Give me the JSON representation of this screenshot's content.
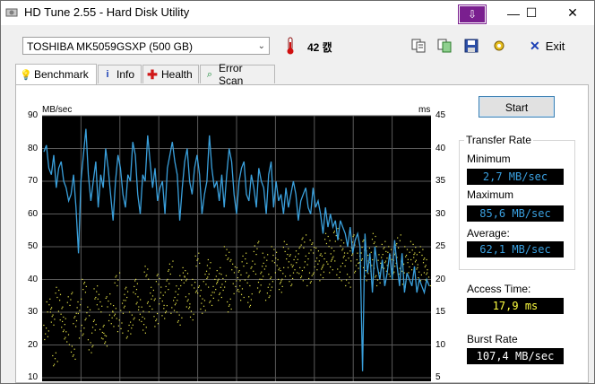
{
  "window": {
    "title": "HD Tune 2.55 - Hard Disk Utility",
    "minimize_glyph": "—",
    "maximize_glyph": "☐",
    "close_glyph": "✕",
    "pin_glyph": "⇩"
  },
  "toolbar": {
    "drive": "TOSHIBA MK5059GSXP (500 GB)",
    "temperature": "42 캜",
    "exit_label": "Exit",
    "icons": [
      "copy-text-icon",
      "copy-screenshot-icon",
      "save-icon",
      "options-icon"
    ]
  },
  "tabs": [
    {
      "label": "Benchmark",
      "icon": "benchmark-icon",
      "active": true
    },
    {
      "label": "Info",
      "icon": "info-icon",
      "active": false
    },
    {
      "label": "Health",
      "icon": "health-cross-icon",
      "active": false
    },
    {
      "label": "Error Scan",
      "icon": "error-scan-icon",
      "active": false
    }
  ],
  "benchmark": {
    "start_label": "Start",
    "transfer_rate_title": "Transfer Rate",
    "minimum_label": "Minimum",
    "minimum_value": "2,7 MB/sec",
    "maximum_label": "Maximum",
    "maximum_value": "85,6 MB/sec",
    "average_label": "Average:",
    "average_value": "62,1 MB/sec",
    "access_label": "Access Time:",
    "access_value": "17,9 ms",
    "burst_label": "Burst Rate",
    "burst_value": "107,4 MB/sec",
    "colors": {
      "transfer": "#3aa0dc",
      "access": "#e8e64a",
      "lcd_blue": "#3aa0e0",
      "lcd_yellow": "#ffff40",
      "lcd_white": "#ffffff"
    }
  },
  "chart_data": {
    "type": "line",
    "left_axis_unit": "MB/sec",
    "right_axis_unit": "ms",
    "left_ticks": [
      "90",
      "80",
      "70",
      "60",
      "50",
      "40",
      "30",
      "20",
      "10"
    ],
    "right_ticks": [
      "45",
      "40",
      "35",
      "30",
      "25",
      "20",
      "15",
      "10",
      "5"
    ],
    "ylim_left": [
      10,
      90
    ],
    "ylim_right": [
      5,
      45
    ],
    "grid": true,
    "series": [
      {
        "axis": "left",
        "values": [
          79,
          81,
          74,
          72,
          78,
          68,
          74,
          76,
          70,
          68,
          64,
          66,
          72,
          62,
          48,
          70,
          78,
          86,
          72,
          64,
          70,
          76,
          62,
          72,
          68,
          80,
          74,
          66,
          58,
          70,
          78,
          74,
          66,
          62,
          72,
          70,
          82,
          78,
          66,
          60,
          72,
          70,
          84,
          76,
          68,
          74,
          64,
          68,
          70,
          60,
          74,
          78,
          82,
          76,
          72,
          58,
          68,
          76,
          80,
          70,
          66,
          74,
          78,
          72,
          60,
          66,
          70,
          84,
          74,
          68,
          70,
          64,
          72,
          62,
          72,
          80,
          76,
          66,
          60,
          70,
          74,
          76,
          66,
          64,
          72,
          68,
          62,
          74,
          70,
          68,
          60,
          72,
          76,
          62,
          70,
          64,
          66,
          60,
          68,
          62,
          66,
          70,
          66,
          58,
          64,
          66,
          68,
          62,
          60,
          68,
          62,
          64,
          60,
          54,
          62,
          56,
          60,
          56,
          58,
          52,
          58,
          56,
          54,
          50,
          56,
          48,
          52,
          54,
          50,
          12,
          54,
          42,
          48,
          36,
          50,
          44,
          40,
          46,
          38,
          42,
          48,
          40,
          52,
          44,
          38,
          48,
          36,
          42,
          40,
          38,
          44,
          36,
          40,
          38,
          36,
          40,
          38
        ]
      },
      {
        "axis": "right",
        "scatter": true,
        "values": [
          12,
          16,
          14,
          8,
          18,
          15,
          13,
          11,
          17,
          9,
          14,
          16,
          12,
          19,
          15,
          10,
          13,
          18,
          16,
          12,
          11,
          17,
          14,
          15,
          20,
          13,
          16,
          18,
          12,
          14,
          19,
          17,
          15,
          13,
          21,
          16,
          18,
          14,
          20,
          17,
          15,
          19,
          22,
          16,
          18,
          14,
          20,
          21,
          17,
          15,
          19,
          23,
          18,
          16,
          20,
          22,
          17,
          19,
          21,
          18,
          20,
          24,
          16,
          22,
          19,
          21,
          18,
          23,
          20,
          17,
          22,
          25,
          19,
          21,
          23,
          18,
          20,
          24,
          22,
          19,
          21,
          25,
          23,
          20,
          22,
          24,
          21,
          26,
          23,
          20,
          25,
          22,
          24,
          21,
          23,
          26,
          22,
          24,
          27,
          21,
          25,
          23,
          20,
          24,
          26,
          22,
          23,
          25,
          21,
          24,
          22,
          26,
          20,
          23,
          25,
          22,
          24,
          21,
          23,
          26,
          22,
          20,
          24,
          22,
          25,
          23,
          21,
          24,
          22,
          20
        ]
      }
    ]
  }
}
